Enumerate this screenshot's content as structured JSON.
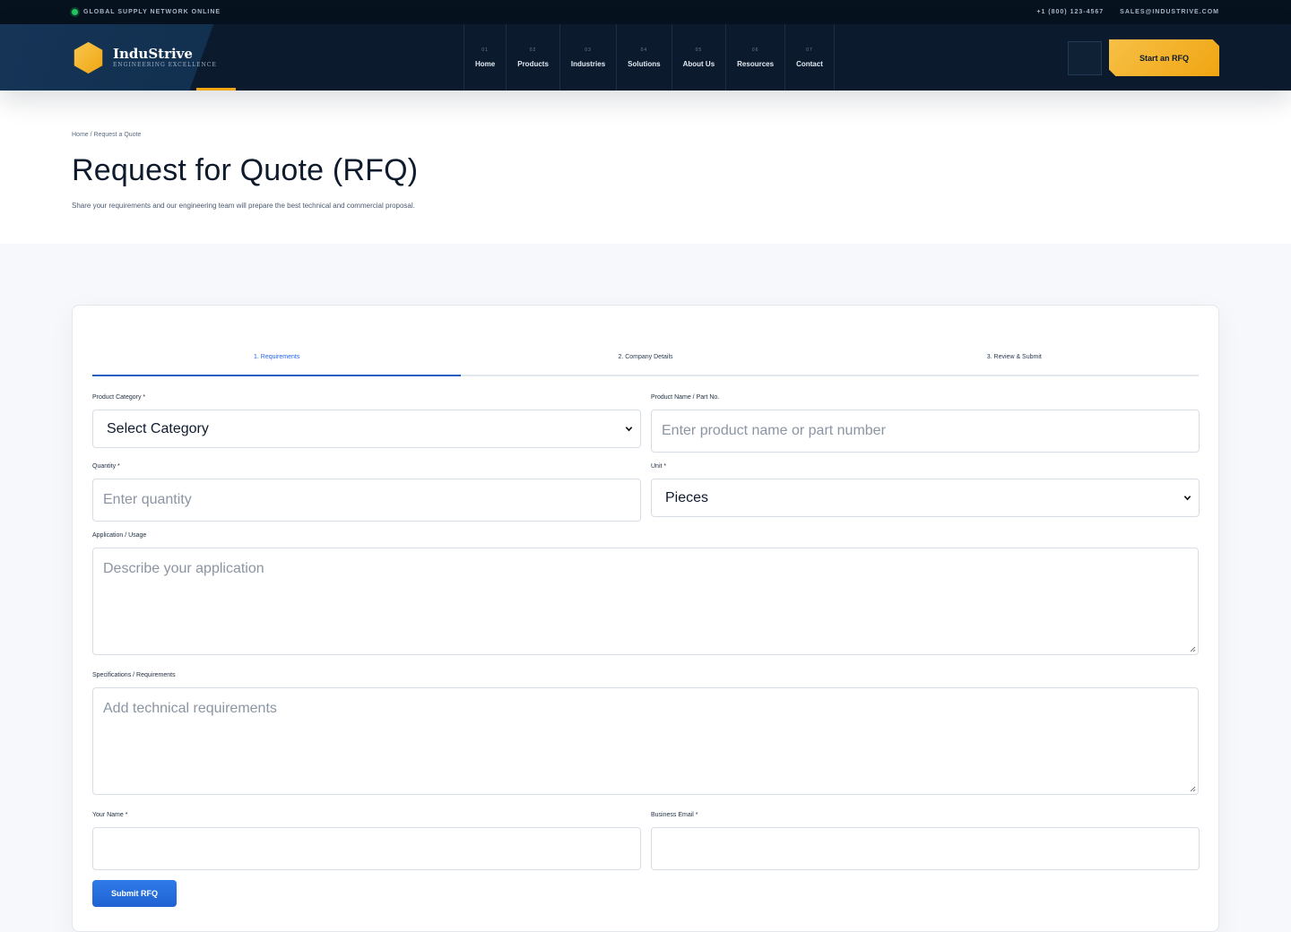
{
  "topbar": {
    "status": "GLOBAL SUPPLY NETWORK ONLINE",
    "phone": "+1 (800) 123-4567",
    "email": "SALES@INDUSTRIVE.COM"
  },
  "brand": {
    "name": "InduStrive",
    "tagline": "ENGINEERING EXCELLENCE"
  },
  "nav": [
    {
      "num": "01",
      "label": "Home"
    },
    {
      "num": "02",
      "label": "Products"
    },
    {
      "num": "03",
      "label": "Industries"
    },
    {
      "num": "04",
      "label": "Solutions"
    },
    {
      "num": "05",
      "label": "About Us"
    },
    {
      "num": "06",
      "label": "Resources"
    },
    {
      "num": "07",
      "label": "Contact"
    }
  ],
  "header": {
    "cta_label": "Start an RFQ"
  },
  "hero": {
    "breadcrumb": "Home / Request a Quote",
    "title": "Request for Quote (RFQ)",
    "subtitle": "Share your requirements and our engineering team will prepare the best technical and commercial proposal."
  },
  "steps": [
    "1. Requirements",
    "2. Company Details",
    "3. Review & Submit"
  ],
  "form": {
    "category": {
      "label": "Product Category *",
      "value": "Select Category"
    },
    "product": {
      "label": "Product Name / Part No.",
      "placeholder": "Enter product name or part number"
    },
    "quantity": {
      "label": "Quantity *",
      "placeholder": "Enter quantity"
    },
    "unit": {
      "label": "Unit *",
      "value": "Pieces"
    },
    "application": {
      "label": "Application / Usage",
      "placeholder": "Describe your application"
    },
    "specs": {
      "label": "Specifications / Requirements",
      "placeholder": "Add technical requirements"
    },
    "name": {
      "label": "Your Name *",
      "placeholder": ""
    },
    "email": {
      "label": "Business Email *",
      "placeholder": ""
    },
    "submit_label": "Submit RFQ"
  },
  "colors": {
    "accent": "#f3a712",
    "primary": "#1f62d1",
    "header_bg": "#0b1a2c"
  }
}
